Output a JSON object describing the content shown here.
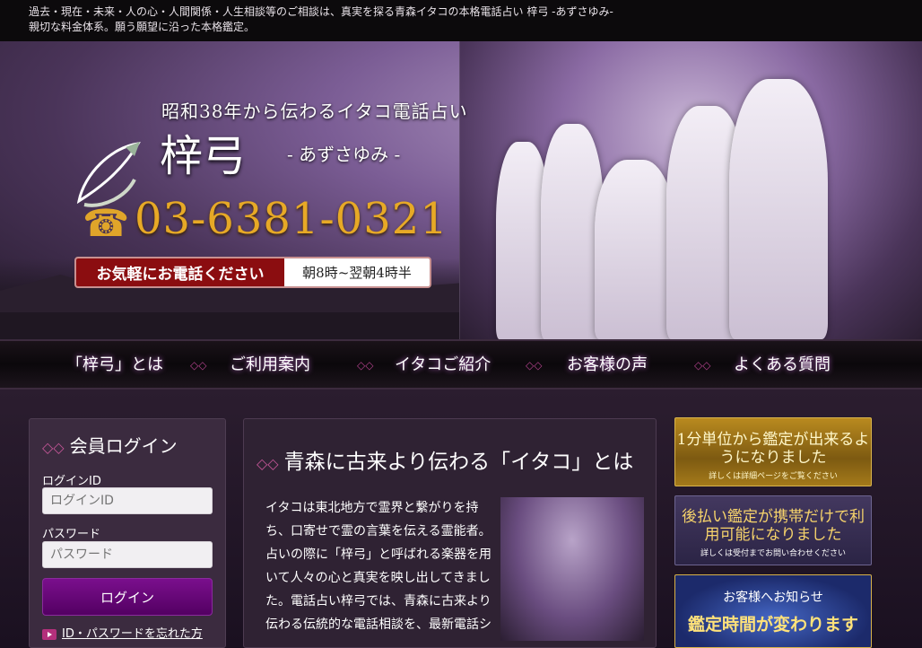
{
  "topbar": {
    "line1": "過去・現在・未来・人の心・人間関係・人生相談等のご相談は、真実を探る青森イタコの本格電話占い 梓弓 -あずさゆみ-",
    "line2": "親切な料金体系。願う願望に沿った本格鑑定。"
  },
  "hero": {
    "tagline": "昭和38年から伝わるイタコ電話占い",
    "brand": "梓弓",
    "brand_sub": "- あずさゆみ -",
    "phone_icon": "☎",
    "phone_number": "03-6381-0321",
    "hours_label": "お気軽にお電話ください",
    "hours_value": "朝8時~翌朝4時半"
  },
  "nav": {
    "items": [
      "「梓弓」とは",
      "ご利用案内",
      "イタコご紹介",
      "お客様の声",
      "よくある質問"
    ]
  },
  "login": {
    "title": "会員ログイン",
    "id_label": "ログインID",
    "id_placeholder": "ログインID",
    "password_label": "パスワード",
    "password_placeholder": "パスワード",
    "button": "ログイン",
    "forgot": "ID・パスワードを忘れた方"
  },
  "main": {
    "title": "青森に古来より伝わる「イタコ」とは",
    "text": "イタコは東北地方で霊界と繋がりを持ち、口寄せで霊の言葉を伝える霊能者。占いの際に「梓弓」と呼ばれる楽器を用いて人々の心と真実を映し出してきました。電話占い梓弓では、青森に古来より伝わる伝統的な電話相談を、最新電話シ"
  },
  "banners": {
    "b1_main": "1分単位から鑑定が出来るようになりました",
    "b1_note": "詳しくは詳細ページをご覧ください",
    "b2_main": "後払い鑑定が携帯だけで利用可能になりました",
    "b2_note": "詳しくは受付までお問い合わせください",
    "b3_small": "お客様へお知らせ",
    "b3_big": "鑑定時間が変わります"
  }
}
